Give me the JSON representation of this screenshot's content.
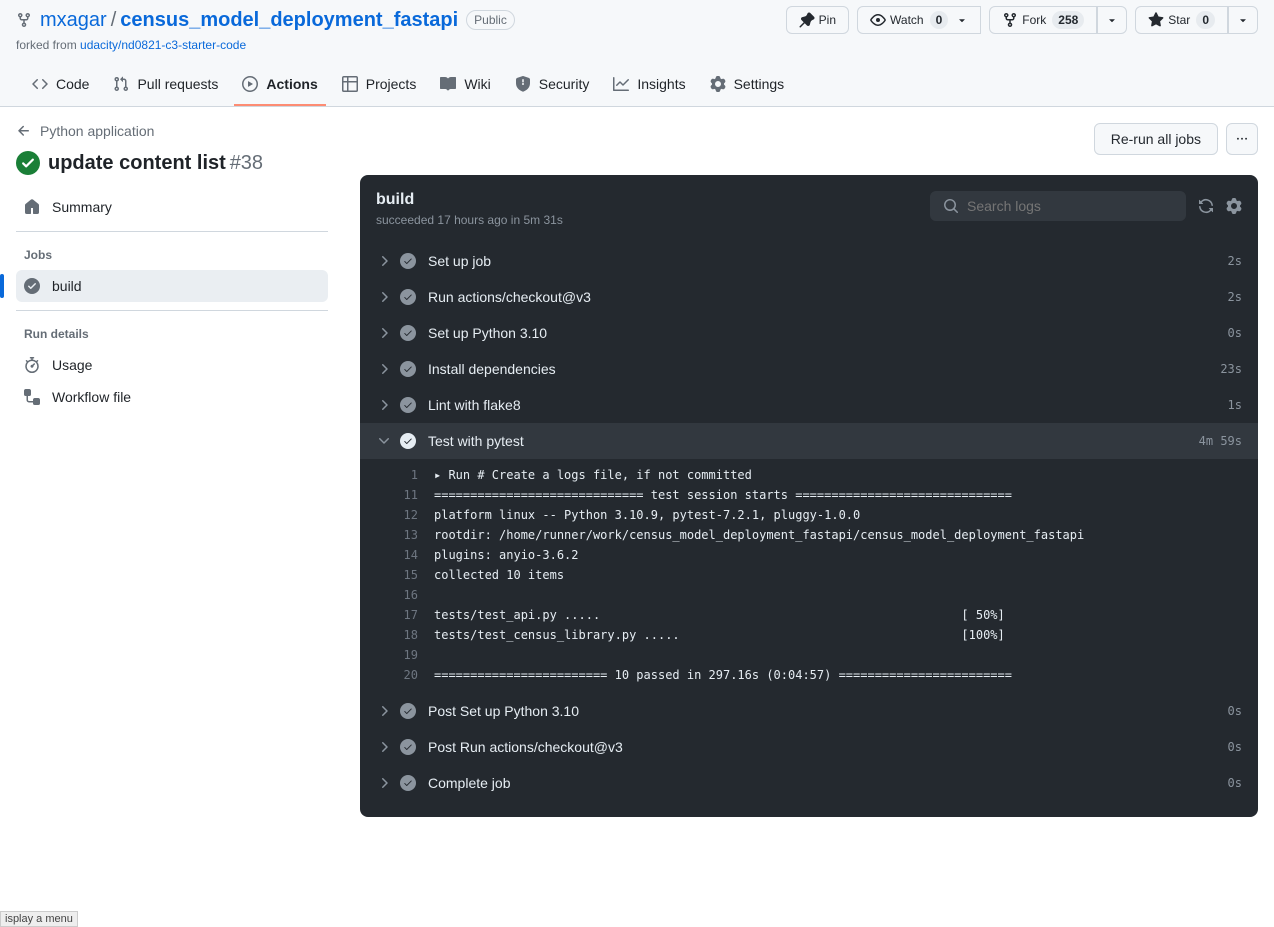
{
  "repo": {
    "owner": "mxagar",
    "name": "census_model_deployment_fastapi",
    "visibility": "Public",
    "forked_prefix": "forked from ",
    "forked_from": "udacity/nd0821-c3-starter-code"
  },
  "actions_bar": {
    "pin": "Pin",
    "watch": "Watch",
    "watch_count": "0",
    "fork": "Fork",
    "fork_count": "258",
    "star": "Star",
    "star_count": "0"
  },
  "tabs": {
    "code": "Code",
    "pull": "Pull requests",
    "actions": "Actions",
    "projects": "Projects",
    "wiki": "Wiki",
    "security": "Security",
    "insights": "Insights",
    "settings": "Settings"
  },
  "crumb": "Python application",
  "run": {
    "title": "update content list",
    "number": "#38",
    "rerun": "Re-run all jobs"
  },
  "sidebar": {
    "summary": "Summary",
    "jobs_label": "Jobs",
    "job_build": "build",
    "details_label": "Run details",
    "usage": "Usage",
    "workflow_file": "Workflow file"
  },
  "panel": {
    "title": "build",
    "sub_prefix": "succeeded ",
    "sub_time": "17 hours ago",
    "sub_in": " in ",
    "sub_dur": "5m 31s",
    "search_placeholder": "Search logs"
  },
  "steps": [
    {
      "name": "Set up job",
      "dur": "2s"
    },
    {
      "name": "Run actions/checkout@v3",
      "dur": "2s"
    },
    {
      "name": "Set up Python 3.10",
      "dur": "0s"
    },
    {
      "name": "Install dependencies",
      "dur": "23s"
    },
    {
      "name": "Lint with flake8",
      "dur": "1s"
    },
    {
      "name": "Test with pytest",
      "dur": "4m 59s"
    },
    {
      "name": "Post Set up Python 3.10",
      "dur": "0s"
    },
    {
      "name": "Post Run actions/checkout@v3",
      "dur": "0s"
    },
    {
      "name": "Complete job",
      "dur": "0s"
    }
  ],
  "log": [
    {
      "n": "1",
      "t": "▸ Run # Create a logs file, if not committed"
    },
    {
      "n": "11",
      "t": "============================= test session starts =============================="
    },
    {
      "n": "12",
      "t": "platform linux -- Python 3.10.9, pytest-7.2.1, pluggy-1.0.0"
    },
    {
      "n": "13",
      "t": "rootdir: /home/runner/work/census_model_deployment_fastapi/census_model_deployment_fastapi"
    },
    {
      "n": "14",
      "t": "plugins: anyio-3.6.2"
    },
    {
      "n": "15",
      "t": "collected 10 items"
    },
    {
      "n": "16",
      "t": ""
    },
    {
      "n": "17",
      "t": "tests/test_api.py .....                                                  [ 50%]"
    },
    {
      "n": "18",
      "t": "tests/test_census_library.py .....                                       [100%]"
    },
    {
      "n": "19",
      "t": ""
    },
    {
      "n": "20",
      "t": "======================== 10 passed in 297.16s (0:04:57) ========================"
    }
  ],
  "status_hint": "isplay a menu"
}
